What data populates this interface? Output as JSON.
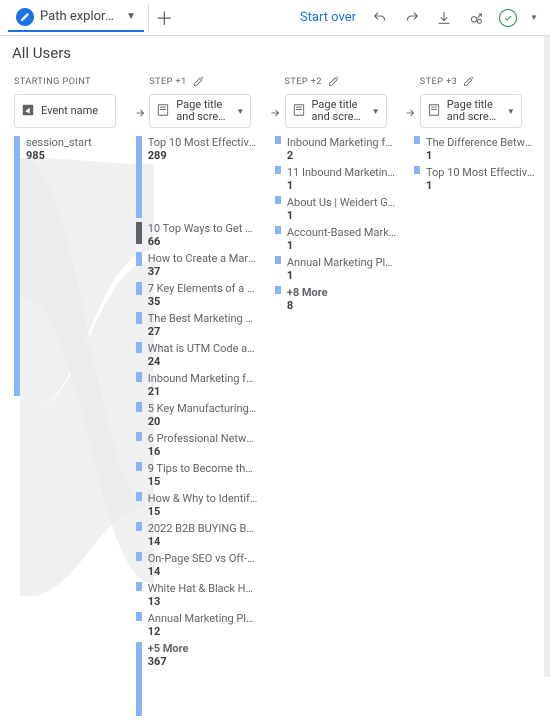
{
  "toolbar": {
    "tab_label": "Path explorati…",
    "start_over": "Start over"
  },
  "title": "All Users",
  "steps": {
    "start_label": "STARTING POINT",
    "step1_label": "STEP +1",
    "step2_label": "STEP +2",
    "step3_label": "STEP +3",
    "event_chip": "Event name",
    "page_chip_line1": "Page title",
    "page_chip_line2": "and scree…"
  },
  "col_start": {
    "items": [
      {
        "name": "session_start",
        "value": "985"
      }
    ]
  },
  "col1": {
    "items": [
      {
        "name": "Top 10 Most Effective …",
        "value": "289",
        "h": 82
      },
      {
        "name": "10 Top Ways to Get M…",
        "value": "66",
        "h": 22
      },
      {
        "name": "How to Create a Mark…",
        "value": "37",
        "h": 14
      },
      {
        "name": "7 Key Elements of a Q…",
        "value": "35",
        "h": 13
      },
      {
        "name": "The Best Marketing Bu…",
        "value": "27",
        "h": 12
      },
      {
        "name": "What is UTM Code an…",
        "value": "24",
        "h": 11
      },
      {
        "name": "Inbound Marketing for …",
        "value": "21",
        "h": 10
      },
      {
        "name": "5 Key Manufacturing C…",
        "value": "20",
        "h": 10
      },
      {
        "name": "6 Professional Networ…",
        "value": "16",
        "h": 9
      },
      {
        "name": "9 Tips to Become the …",
        "value": "15",
        "h": 9
      },
      {
        "name": "How & Why to Identify …",
        "value": "15",
        "h": 9
      },
      {
        "name": "2022 B2B BUYING BE…",
        "value": "14",
        "h": 9
      },
      {
        "name": "On-Page SEO vs Off-P…",
        "value": "14",
        "h": 9
      },
      {
        "name": "White Hat & Black Hat …",
        "value": "13",
        "h": 9
      },
      {
        "name": "Annual Marketing Plan …",
        "value": "12",
        "h": 9
      }
    ],
    "more_label": "+5 More",
    "more_value": "367",
    "more_h": 74
  },
  "col2": {
    "items": [
      {
        "name": "Inbound Marketing for …",
        "value": "2",
        "h": 8
      },
      {
        "name": "11 Inbound Marketing …",
        "value": "1",
        "h": 8
      },
      {
        "name": "About Us | Weidert Gro…",
        "value": "1",
        "h": 8
      },
      {
        "name": "Account-Based Market…",
        "value": "1",
        "h": 8
      },
      {
        "name": "Annual Marketing Plan …",
        "value": "1",
        "h": 8
      }
    ],
    "more_label": "+8 More",
    "more_value": "8",
    "more_h": 8
  },
  "col3": {
    "items": [
      {
        "name": "The Difference Betwee…",
        "value": "1",
        "h": 8
      },
      {
        "name": "Top 10 Most Effective …",
        "value": "1",
        "h": 8
      }
    ]
  }
}
